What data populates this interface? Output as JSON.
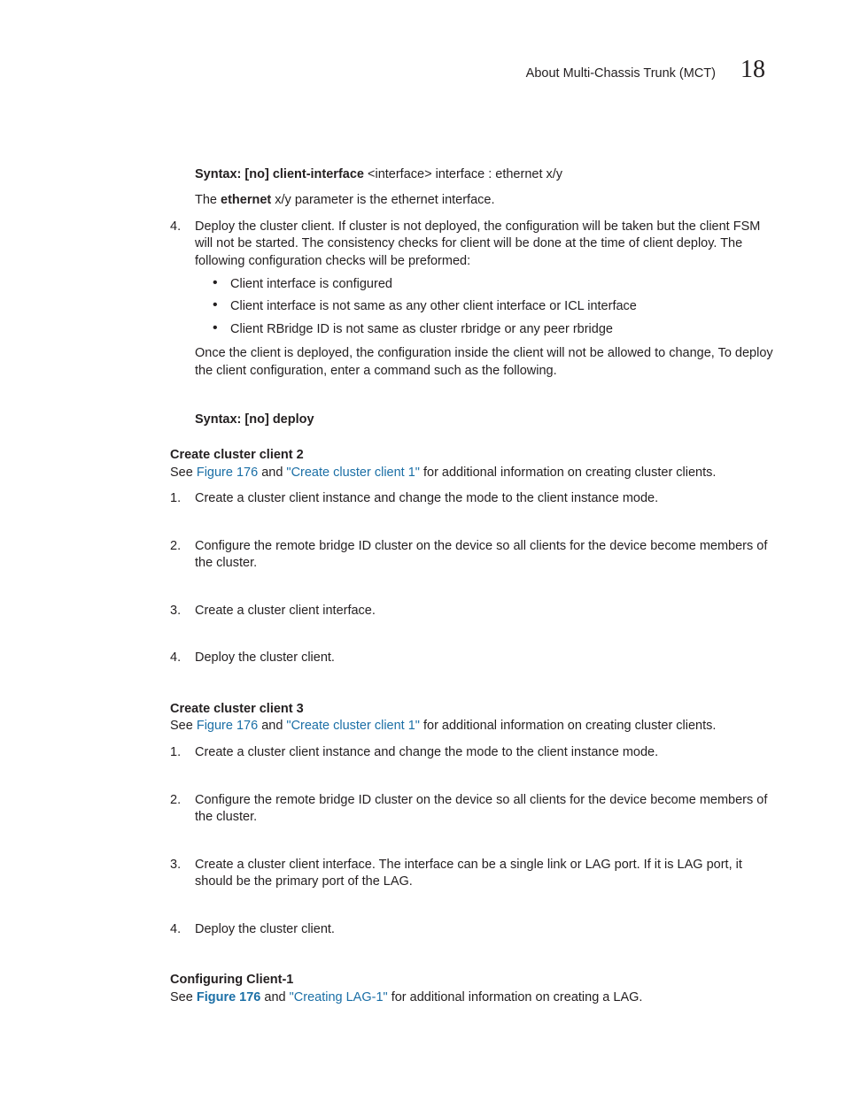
{
  "header": {
    "title": "About Multi-Chassis Trunk (MCT)",
    "chapter_number": "18"
  },
  "syntax1": {
    "label": "Syntax:  ",
    "cmd": "[no] client-interface ",
    "rest": "<interface> interface : ethernet x/y"
  },
  "para1_a": "The ",
  "para1_b": "ethernet",
  "para1_c": " x/y parameter is the ethernet interface.",
  "step4": {
    "num": "4.",
    "text": "Deploy the cluster client. If cluster is not deployed, the configuration will be taken but the client FSM will not be started. The consistency checks for client will be done at the time of client deploy. The following configuration checks will be preformed:",
    "bullets": [
      "Client interface is configured",
      "Client interface is not same as any other client interface or ICL interface",
      "Client RBridge ID is not same as cluster rbridge or any peer rbridge"
    ],
    "after": "Once the client is deployed, the configuration inside the client will not be allowed to change, To deploy the client configuration, enter a command such as the following."
  },
  "syntax2": {
    "label": "Syntax:  ",
    "cmd": "[no] deploy"
  },
  "ccc2": {
    "heading": "Create cluster client 2",
    "see_a": "See ",
    "link1": "Figure 176",
    "see_b": " and ",
    "link2": "\"Create cluster client 1\"",
    "see_c": " for additional information on creating cluster clients.",
    "steps": [
      {
        "num": "1.",
        "text": "Create a cluster client instance and change the mode to the client instance mode."
      },
      {
        "num": "2.",
        "text": "Configure the remote bridge ID cluster on the device so all clients for the device become members of the cluster."
      },
      {
        "num": "3.",
        "text": "Create a cluster client interface."
      },
      {
        "num": "4.",
        "text": "Deploy the cluster client."
      }
    ]
  },
  "ccc3": {
    "heading": "Create cluster client 3",
    "see_a": "See ",
    "link1": "Figure 176",
    "see_b": " and ",
    "link2": "\"Create cluster client 1\"",
    "see_c": " for additional information on creating cluster clients.",
    "steps": [
      {
        "num": "1.",
        "text": "Create a cluster client instance and change the mode to the client instance mode."
      },
      {
        "num": "2.",
        "text": "Configure the remote bridge ID cluster on the device so all clients for the device become members of the cluster."
      },
      {
        "num": "3.",
        "text": "Create a cluster client interface. The interface can be a single link or LAG port. If it is LAG port, it should be the primary port of the LAG."
      },
      {
        "num": "4.",
        "text": "Deploy the cluster client."
      }
    ]
  },
  "cfg1": {
    "heading": "Configuring Client-1",
    "see_a": "See ",
    "link1": "Figure 176",
    "see_b": " and ",
    "link2": "\"Creating LAG-1\"",
    "see_c": " for additional information on creating a LAG."
  }
}
